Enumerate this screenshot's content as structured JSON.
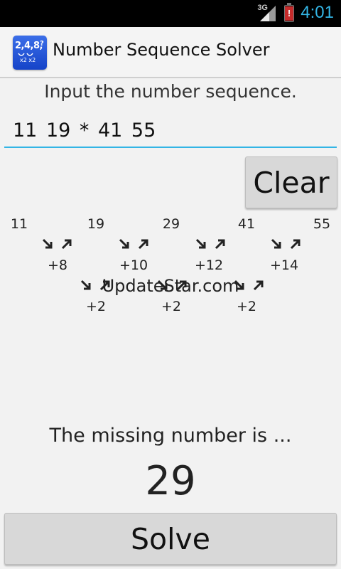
{
  "status_bar": {
    "network": "3G",
    "time": "4:01",
    "battery_alert": "!",
    "time_color": "#33b5e5"
  },
  "action_bar": {
    "app_icon_text": "2,4,8,",
    "app_icon_sub": "x2 x2",
    "app_icon_mark": "?",
    "title": "Number Sequence Solver"
  },
  "input": {
    "label": "Input the number sequence.",
    "value": "11 19 * 41 55",
    "underline_color": "#33b5e5"
  },
  "clear_label": "Clear",
  "diagram": {
    "terms": [
      "11",
      "19",
      "29",
      "41",
      "55"
    ],
    "first_differences": [
      "+8",
      "+10",
      "+12",
      "+14"
    ],
    "second_differences": [
      "+2",
      "+2",
      "+2"
    ]
  },
  "watermark": "UpdateStar.com",
  "result": {
    "label": "The missing number is ...",
    "value": "29"
  },
  "solve_label": "Solve"
}
